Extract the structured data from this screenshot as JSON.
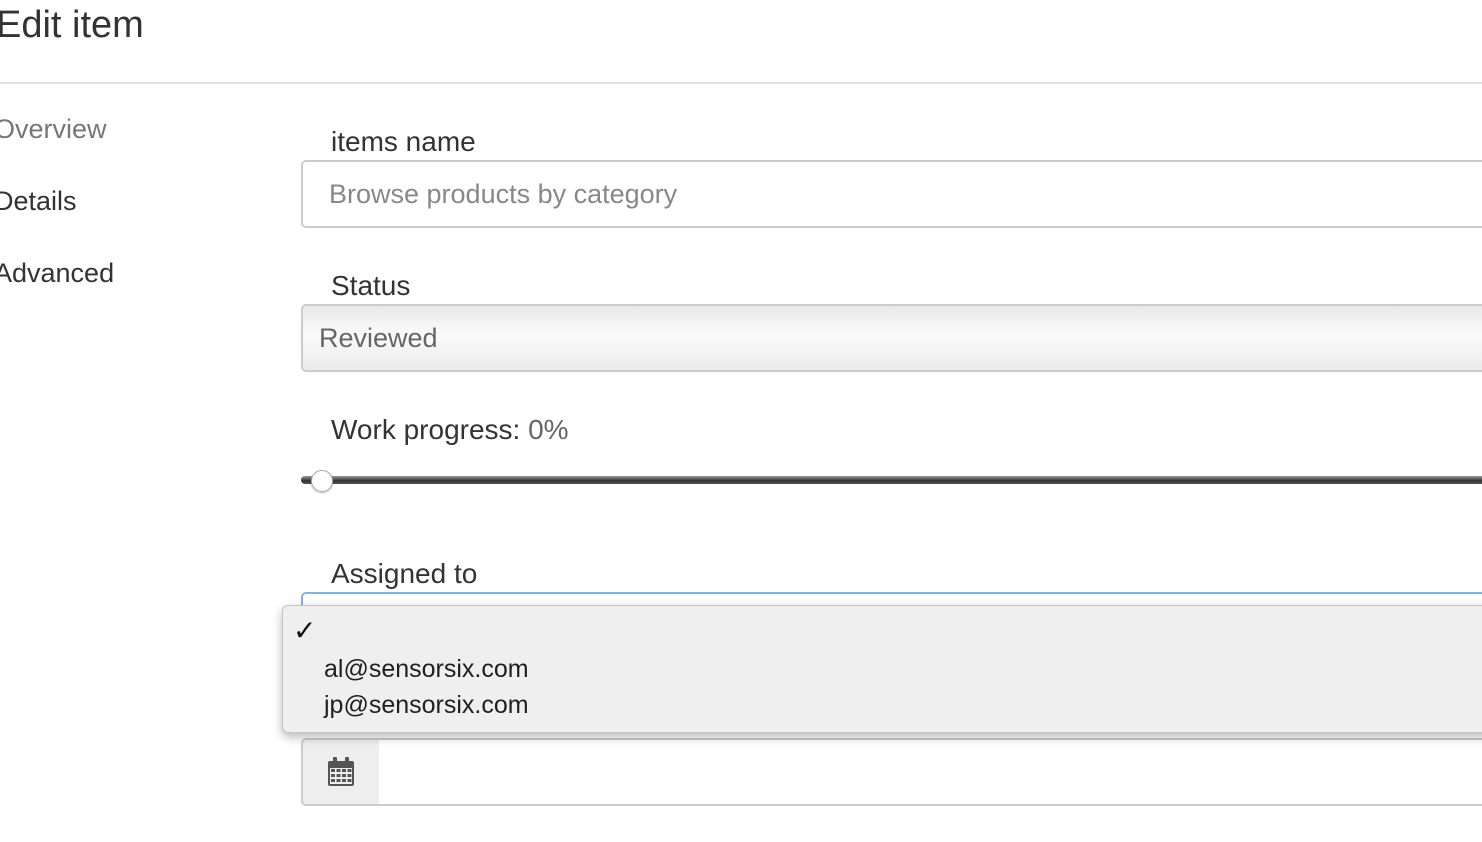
{
  "page": {
    "title": "Edit item"
  },
  "sidebar": {
    "items": [
      {
        "label": "Overview",
        "active": true
      },
      {
        "label": "Details",
        "active": false
      },
      {
        "label": "Advanced",
        "active": false
      }
    ]
  },
  "form": {
    "name": {
      "label": "items name",
      "value": "Browse products by category"
    },
    "status": {
      "label": "Status",
      "value": "Reviewed"
    },
    "progress": {
      "label": "Work progress:",
      "value_text": "0%",
      "value": 0
    },
    "assigned": {
      "label": "Assigned to",
      "selected_index": 0,
      "options": [
        {
          "label": ""
        },
        {
          "label": "al@sensorsix.com"
        },
        {
          "label": "jp@sensorsix.com"
        }
      ]
    },
    "date": {
      "icon": "calendar-icon",
      "value": ""
    }
  },
  "colors": {
    "focus_border": "#7eb3e6",
    "dropdown_bg": "#efefef"
  }
}
